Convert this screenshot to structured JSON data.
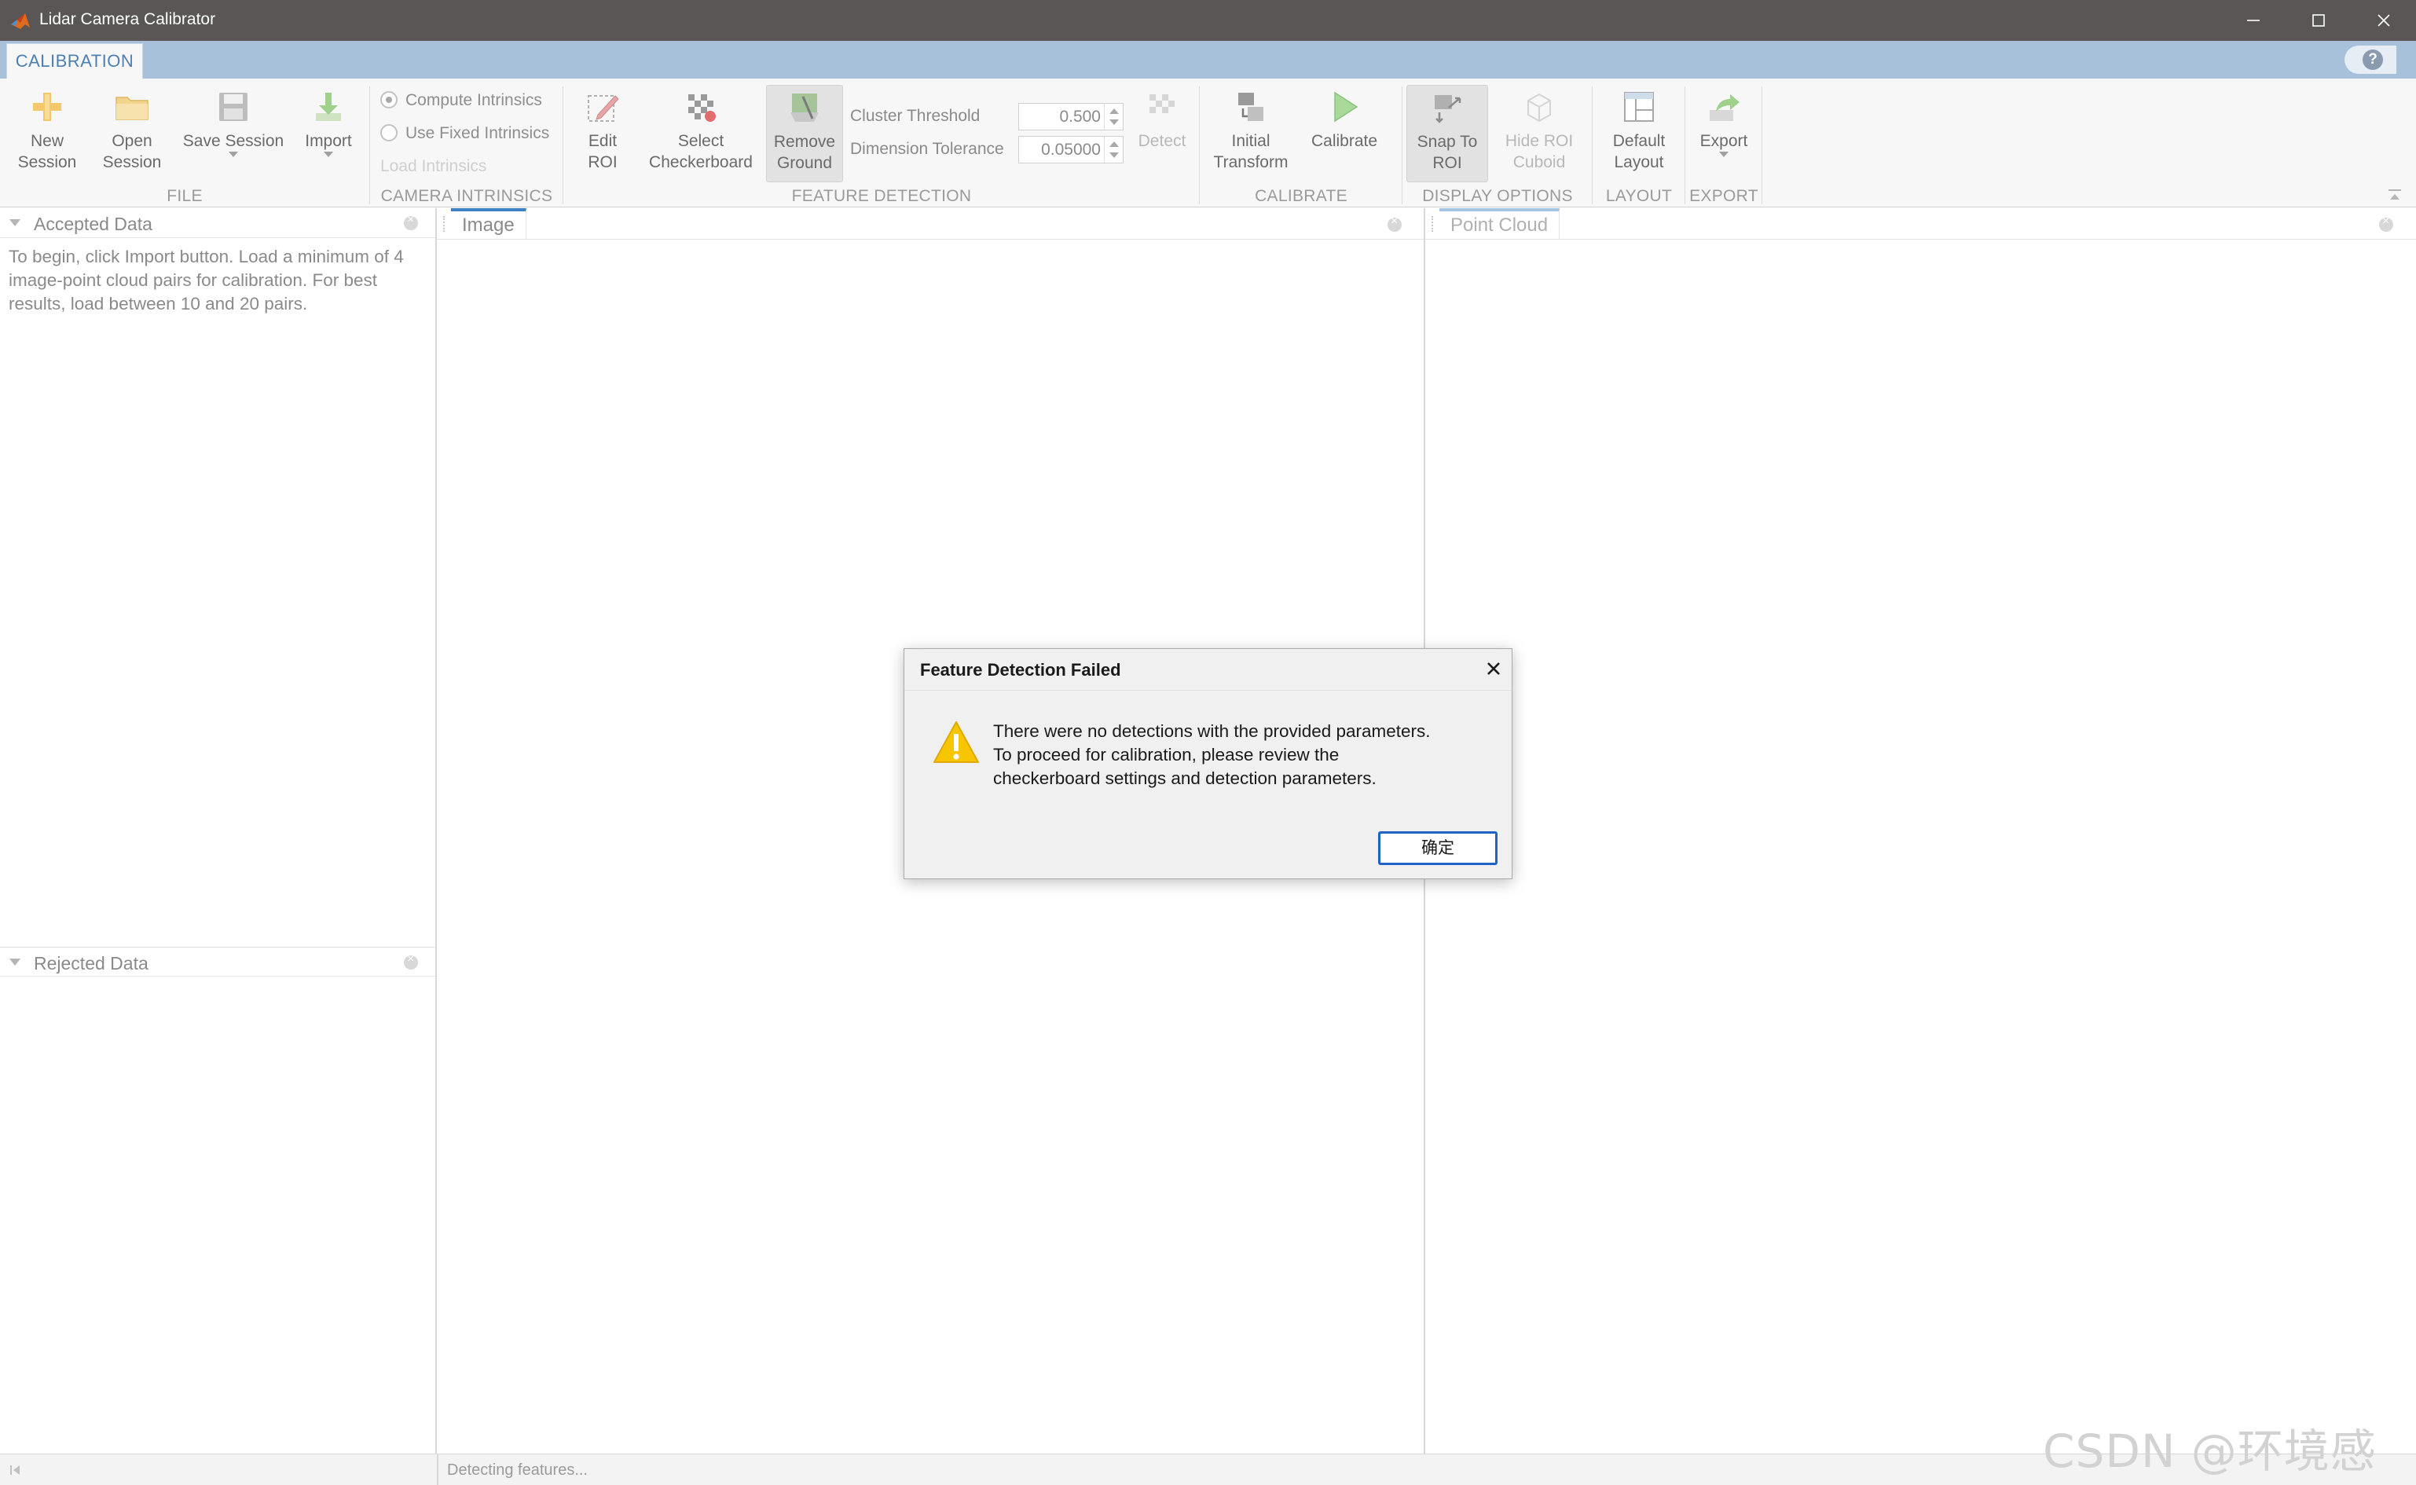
{
  "window": {
    "title": "Lidar Camera Calibrator",
    "controls": [
      "minimize-icon",
      "maximize-icon",
      "close-icon"
    ]
  },
  "tabs": [
    {
      "label": "CALIBRATION",
      "selected": true
    }
  ],
  "toolstrip": {
    "file": {
      "section": "FILE",
      "new_session": [
        "New",
        "Session"
      ],
      "open_session": [
        "Open",
        "Session"
      ],
      "save_session": "Save Session",
      "import": "Import"
    },
    "camera_intrinsics": {
      "section": "CAMERA INTRINSICS",
      "compute": "Compute Intrinsics",
      "use_fixed": "Use Fixed Intrinsics",
      "load": "Load Intrinsics",
      "selected": "compute"
    },
    "feature_detection": {
      "section": "FEATURE DETECTION",
      "edit_roi": [
        "Edit",
        "ROI"
      ],
      "select_checkerboard": [
        "Select",
        "Checkerboard"
      ],
      "remove_ground": [
        "Remove",
        "Ground"
      ],
      "cluster_threshold_label": "Cluster Threshold",
      "cluster_threshold_value": "0.500",
      "dimension_tolerance_label": "Dimension Tolerance",
      "dimension_tolerance_value": "0.05000",
      "detect": "Detect"
    },
    "calibrate": {
      "section": "CALIBRATE",
      "initial_transform": [
        "Initial",
        "Transform"
      ],
      "calibrate": "Calibrate"
    },
    "display_options": {
      "section": "DISPLAY OPTIONS",
      "snap_to_roi": [
        "Snap To",
        "ROI"
      ],
      "hide_roi_cuboid": [
        "Hide ROI",
        "Cuboid"
      ]
    },
    "layout": {
      "section": "LAYOUT",
      "default_layout": [
        "Default",
        "Layout"
      ]
    },
    "export": {
      "section": "EXPORT",
      "export": "Export"
    }
  },
  "left_panel": {
    "accepted_title": "Accepted Data",
    "accepted_hint": "To begin, click Import button. Load a minimum of 4 image-point cloud pairs for calibration. For best results, load between 10 and 20 pairs.",
    "rejected_title": "Rejected Data"
  },
  "documents": {
    "image_tab": "Image",
    "point_cloud_tab": "Point Cloud"
  },
  "status": {
    "message": "Detecting features..."
  },
  "dialog": {
    "title": "Feature Detection Failed",
    "message_lines": [
      "There were no detections with the provided parameters.",
      "To proceed for calibration, please review the",
      "checkerboard settings and detection parameters."
    ],
    "ok_label": "确定",
    "icon": "warning-icon"
  },
  "watermark": "CSDN @环境感知",
  "colors": {
    "titlebar": "#595655",
    "tabstrip": "#a8c1da",
    "accent_blue": "#3f7fc4",
    "warning_yellow": "#f7c600",
    "ok_border": "#1f62c8"
  }
}
